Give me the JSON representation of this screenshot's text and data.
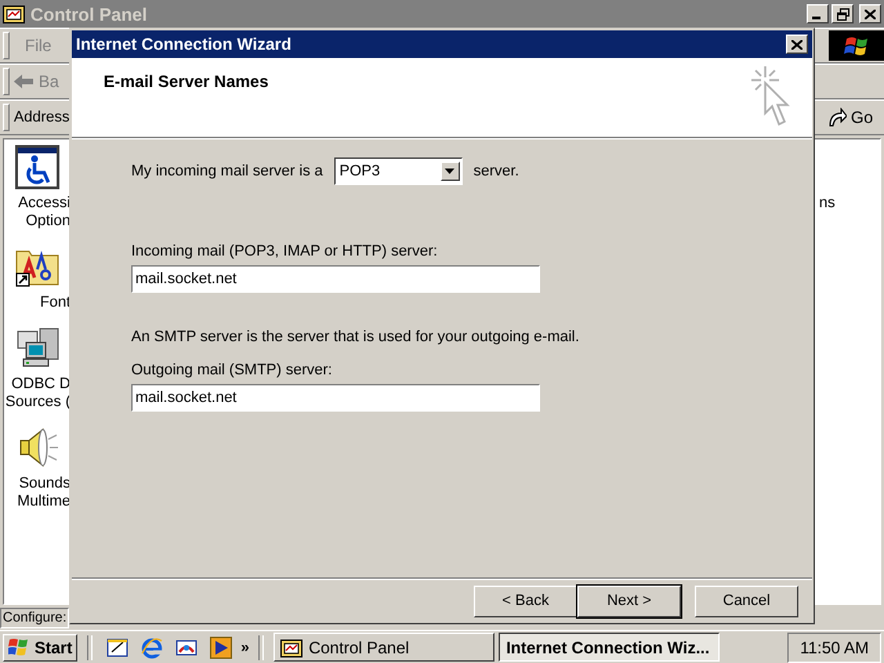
{
  "control_panel": {
    "title": "Control Panel",
    "menu": [
      {
        "label": "File"
      }
    ],
    "back_label": "Ba",
    "address_label": "Address",
    "go_label": "Go",
    "icons": [
      {
        "kind": "accessibility",
        "lines": [
          "Accessi",
          "Option"
        ]
      },
      {
        "kind": "fonts",
        "lines": [
          "Font"
        ]
      },
      {
        "kind": "odbc",
        "lines": [
          "ODBC D",
          "Sources ("
        ]
      },
      {
        "kind": "sounds",
        "lines": [
          "Sounds",
          "Multime"
        ]
      }
    ],
    "right_text": "ns",
    "status": "Configure:"
  },
  "wizard": {
    "title": "Internet Connection Wizard",
    "heading": "E-mail Server Names",
    "server_type": {
      "prefix": "My incoming mail server is a",
      "value": "POP3",
      "suffix": "server."
    },
    "incoming": {
      "label": "Incoming mail (POP3, IMAP or HTTP) server:",
      "value": "mail.socket.net"
    },
    "smtp_note": "An SMTP server is the server that is used for your outgoing e-mail.",
    "outgoing": {
      "label": "Outgoing mail (SMTP) server:",
      "value": "mail.socket.net"
    },
    "buttons": [
      {
        "label": "< Back",
        "default": false
      },
      {
        "label": "Next >",
        "default": true
      },
      {
        "label": "Cancel",
        "default": false
      }
    ]
  },
  "taskbar": {
    "start": "Start",
    "quick_launch": [
      {
        "kind": "desktop"
      },
      {
        "kind": "browser"
      },
      {
        "kind": "channels"
      },
      {
        "kind": "media"
      }
    ],
    "more": "»",
    "tasks": [
      {
        "label": "Control Panel",
        "selected": false
      },
      {
        "label": "Internet Connection Wiz...",
        "selected": true
      }
    ],
    "clock": "11:50 AM"
  }
}
